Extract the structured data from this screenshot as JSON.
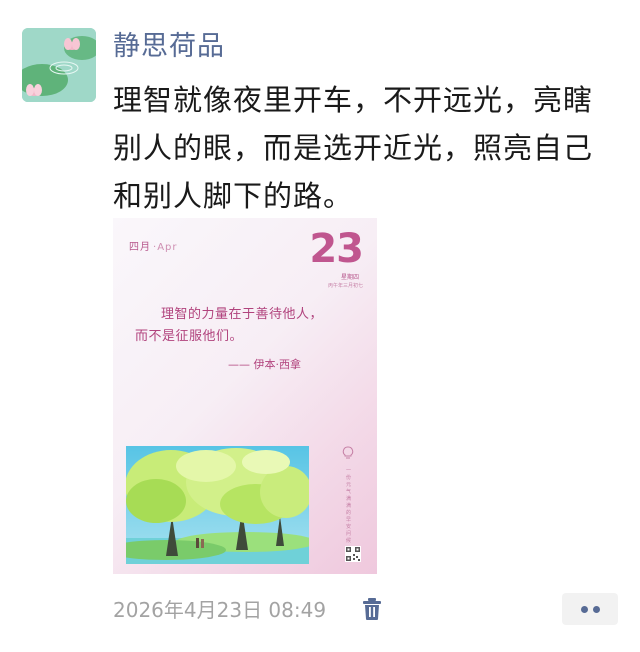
{
  "post": {
    "username": "静思荷品",
    "text": "理智就像夜里开车，不开远光，亮瞎别人的眼，而是选开近光，照亮自己和别人脚下的路。",
    "timestamp": "2026年4月23日 08:49"
  },
  "card": {
    "month_cn": "四月",
    "month_en": "Apr",
    "day": "23",
    "weekday": "星期四",
    "lunar": "丙午年三月初七",
    "quote": "理智的力量在于善待他人，而不是征服他们。",
    "author": "—— 伊本·西拿",
    "side_text": "一份元气满满的早安问候"
  },
  "icons": {
    "avatar": "lotus-pond-avatar",
    "delete": "trash-icon",
    "more": "more-dots-icon",
    "bulb": "lightbulb-icon",
    "qr": "qr-code-icon"
  },
  "colors": {
    "username": "#576b95",
    "card_accent": "#c0568f",
    "timestamp": "#a3a3a3",
    "more_bg": "#f2f2f2"
  }
}
